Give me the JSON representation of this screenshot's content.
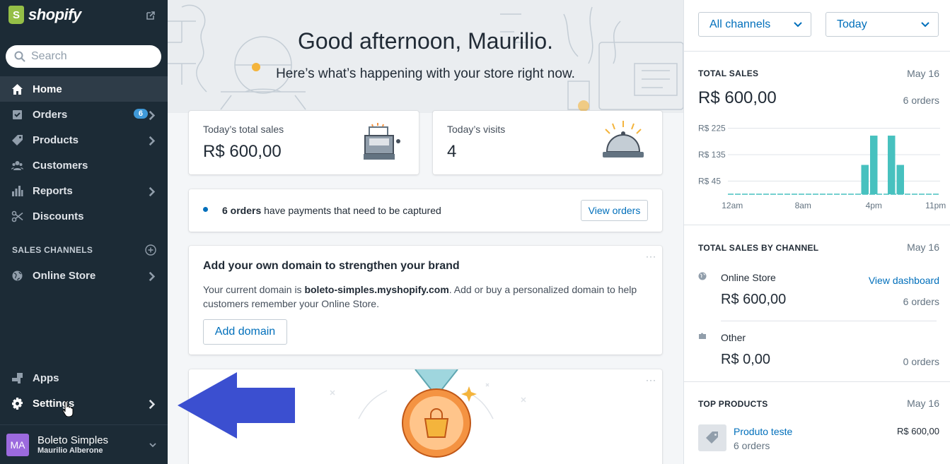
{
  "sidebar": {
    "brand": "shopify",
    "search_placeholder": "Search",
    "items": [
      {
        "label": "Home"
      },
      {
        "label": "Orders",
        "badge": "6"
      },
      {
        "label": "Products"
      },
      {
        "label": "Customers"
      },
      {
        "label": "Reports"
      },
      {
        "label": "Discounts"
      }
    ],
    "sales_channels_heading": "SALES CHANNELS",
    "online_store": "Online Store",
    "apps": "Apps",
    "settings": "Settings",
    "store": {
      "initials": "MA",
      "name": "Boleto Simples",
      "user": "Maurilio Alberone"
    }
  },
  "main": {
    "greeting": "Good afternoon, Maurilio.",
    "subtitle": "Here’s what’s happening with your store right now.",
    "sales_card": {
      "label": "Today’s total sales",
      "value": "R$ 600,00"
    },
    "visits_card": {
      "label": "Today’s visits",
      "value": "4"
    },
    "payments": {
      "count": "6 orders",
      "text": "have payments that need to be captured",
      "button": "View orders"
    },
    "domain": {
      "title": "Add your own domain to strengthen your brand",
      "text_before": "Your current domain is",
      "domain": "boleto-simples.myshopify.com",
      "text_after": ". Add or buy a personalized domain to help customers remember your Online Store.",
      "button": "Add domain"
    }
  },
  "right": {
    "channel_filter": "All channels",
    "date_filter": "Today",
    "total_sales": {
      "title": "TOTAL SALES",
      "date": "May 16",
      "value": "R$ 600,00",
      "orders": "6 orders"
    },
    "by_channel": {
      "title": "TOTAL SALES BY CHANNEL",
      "date": "May 16",
      "channels": [
        {
          "name": "Online Store",
          "link": "View dashboard",
          "value": "R$ 600,00",
          "orders": "6 orders"
        },
        {
          "name": "Other",
          "value": "R$ 0,00",
          "orders": "0 orders"
        }
      ]
    },
    "top_products": {
      "title": "TOP PRODUCTS",
      "date": "May 16",
      "items": [
        {
          "name": "Produto teste",
          "orders": "6 orders",
          "value": "R$ 600,00"
        }
      ]
    }
  },
  "chart_data": {
    "type": "bar",
    "y_tick_labels": [
      "R$ 225",
      "R$ 135",
      "R$ 45"
    ],
    "y_ticks": [
      225,
      135,
      45
    ],
    "x_tick_labels": [
      "12am",
      "8am",
      "4pm",
      "11pm"
    ],
    "x_ticks": [
      0,
      8,
      16,
      23
    ],
    "hours": [
      0,
      1,
      2,
      3,
      4,
      5,
      6,
      7,
      8,
      9,
      10,
      11,
      12,
      13,
      14,
      15,
      16,
      17,
      18,
      19,
      20,
      21,
      22,
      23
    ],
    "values": [
      0,
      0,
      0,
      0,
      0,
      0,
      0,
      0,
      0,
      0,
      0,
      0,
      0,
      0,
      0,
      100,
      200,
      0,
      200,
      100,
      0,
      0,
      0,
      0
    ],
    "ylim": [
      0,
      270
    ],
    "color": "#47c1bf",
    "grid": true
  },
  "colors": {
    "sidebar": "#1c2b36",
    "accent": "#006fbb",
    "badge": "#3f99d8",
    "arrow": "#3b4fd0"
  }
}
